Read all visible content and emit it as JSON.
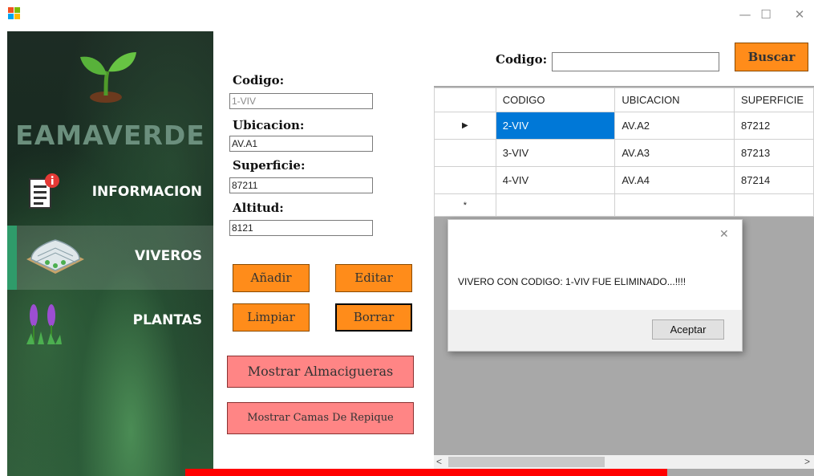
{
  "window": {
    "minimize_icon": "—",
    "maximize_icon": "☐",
    "close_icon": "✕"
  },
  "sidebar": {
    "brand": "EAMAVERDE",
    "items": [
      {
        "label": "INFORMACION",
        "icon": "document-info-icon"
      },
      {
        "label": "VIVEROS",
        "icon": "greenhouse-icon",
        "active": true
      },
      {
        "label": "PLANTAS",
        "icon": "lavender-plant-icon"
      }
    ]
  },
  "form": {
    "codigo_label": "Codigo:",
    "codigo_value": "1-VIV",
    "ubicacion_label": "Ubicacion:",
    "ubicacion_value": "AV.A1",
    "superficie_label": "Superficie:",
    "superficie_value": "87211",
    "altitud_label": "Altitud:",
    "altitud_value": "8121",
    "buttons": {
      "add": "Añadir",
      "edit": "Editar",
      "clear": "Limpiar",
      "delete": "Borrar",
      "show_seedbeds": "Mostrar Almacigueras",
      "show_transplant_beds": "Mostrar Camas De Repique"
    }
  },
  "search": {
    "label": "Codigo:",
    "value": "",
    "button": "Buscar"
  },
  "grid": {
    "columns": [
      "CODIGO",
      "UBICACION",
      "SUPERFICIE"
    ],
    "current_row_marker": "▶",
    "new_row_marker": "*",
    "rows": [
      {
        "codigo": "2-VIV",
        "ubicacion": "AV.A2",
        "superficie": "87212"
      },
      {
        "codigo": "3-VIV",
        "ubicacion": "AV.A3",
        "superficie": "87213"
      },
      {
        "codigo": "4-VIV",
        "ubicacion": "AV.A4",
        "superficie": "87214"
      }
    ],
    "scroll_left": "<",
    "scroll_right": ">"
  },
  "dialog": {
    "close_icon": "✕",
    "message": "VIVERO CON CODIGO: 1-VIV FUE ELIMINADO...!!!!",
    "ok_button": "Aceptar"
  },
  "colors": {
    "accent_orange": "#ff8c1a",
    "accent_pink": "#ff8585",
    "selection_blue": "#0078d7",
    "active_nav_bar": "#2f9b6a",
    "red_bar": "#ff0000"
  }
}
